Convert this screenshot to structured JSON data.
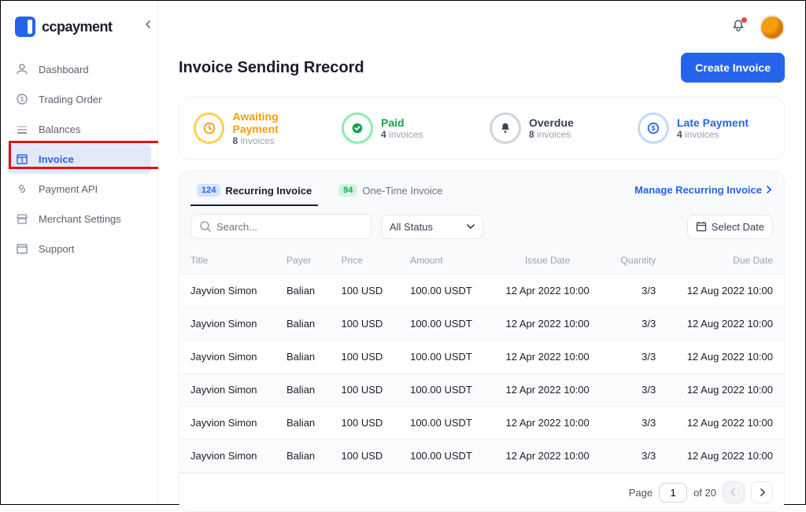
{
  "brand": "ccpayment",
  "sidebar": {
    "items": [
      {
        "label": "Dashboard"
      },
      {
        "label": "Trading Order"
      },
      {
        "label": "Balances"
      },
      {
        "label": "Invoice"
      },
      {
        "label": "Payment API"
      },
      {
        "label": "Merchant Settings"
      },
      {
        "label": "Support"
      }
    ]
  },
  "page": {
    "title": "Invoice Sending Rrecord",
    "create_btn": "Create Invoice"
  },
  "status": {
    "await": {
      "label": "Awaiting Payment",
      "count": "8",
      "suffix": "invoices"
    },
    "paid": {
      "label": "Paid",
      "count": "4",
      "suffix": "invoices"
    },
    "overdue": {
      "label": "Overdue",
      "count": "8",
      "suffix": "invoices"
    },
    "late": {
      "label": "Late Payment",
      "count": "4",
      "suffix": "invoices"
    }
  },
  "tabs": {
    "recurring": {
      "badge": "124",
      "label": "Recurring Invoice"
    },
    "onetime": {
      "badge": "94",
      "label": "One-Time Invoice"
    },
    "manage": "Manage Recurring Invoice"
  },
  "filters": {
    "search_placeholder": "Search...",
    "status_label": "All Status",
    "date_btn": "Select Date"
  },
  "columns": {
    "title": "Title",
    "payer": "Payer",
    "price": "Price",
    "amount": "Amount",
    "issue": "Issue Date",
    "qty": "Quantity",
    "due": "Due Date"
  },
  "rows": [
    {
      "title": "Jayvion Simon",
      "payer": "Balian",
      "price": "100 USD",
      "amount": "100.00 USDT",
      "issue": "12 Apr 2022 10:00",
      "qty": "3/3",
      "due": "12 Aug 2022 10:00"
    },
    {
      "title": "Jayvion Simon",
      "payer": "Balian",
      "price": "100 USD",
      "amount": "100.00 USDT",
      "issue": "12 Apr 2022 10:00",
      "qty": "3/3",
      "due": "12 Aug 2022 10:00"
    },
    {
      "title": "Jayvion Simon",
      "payer": "Balian",
      "price": "100 USD",
      "amount": "100.00 USDT",
      "issue": "12 Apr 2022 10:00",
      "qty": "3/3",
      "due": "12 Aug 2022 10:00"
    },
    {
      "title": "Jayvion Simon",
      "payer": "Balian",
      "price": "100 USD",
      "amount": "100.00 USDT",
      "issue": "12 Apr 2022 10:00",
      "qty": "3/3",
      "due": "12 Aug 2022 10:00"
    },
    {
      "title": "Jayvion Simon",
      "payer": "Balian",
      "price": "100 USD",
      "amount": "100.00 USDT",
      "issue": "12 Apr 2022 10:00",
      "qty": "3/3",
      "due": "12 Aug 2022 10:00"
    },
    {
      "title": "Jayvion Simon",
      "payer": "Balian",
      "price": "100 USD",
      "amount": "100.00 USDT",
      "issue": "12 Apr 2022 10:00",
      "qty": "3/3",
      "due": "12 Aug 2022 10:00"
    }
  ],
  "pager": {
    "label": "Page",
    "current": "1",
    "of": "of 20"
  }
}
